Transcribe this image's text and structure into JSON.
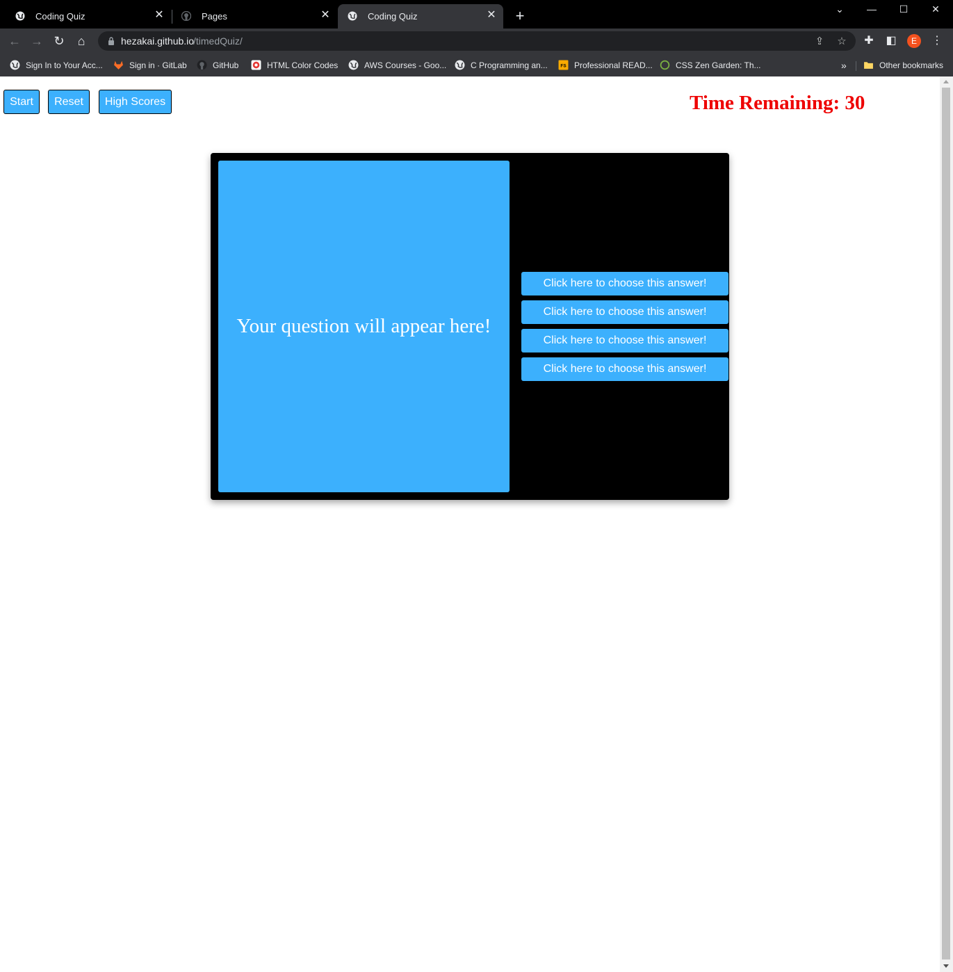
{
  "browser": {
    "tabs": [
      {
        "title": "Coding Quiz",
        "icon": "globe-icon",
        "active": false
      },
      {
        "title": "Pages",
        "icon": "github-icon",
        "active": false
      },
      {
        "title": "Coding Quiz",
        "icon": "globe-icon",
        "active": true
      }
    ],
    "address": {
      "host": "hezakai.github.io",
      "path": "/timedQuiz/"
    },
    "profile_initial": "E",
    "bookmarks": [
      {
        "label": "Sign In to Your Acc...",
        "icon": "globe-icon"
      },
      {
        "label": "Sign in · GitLab",
        "icon": "gitlab-icon"
      },
      {
        "label": "GitHub",
        "icon": "github-icon"
      },
      {
        "label": "HTML Color Codes",
        "icon": "html-color-codes-icon"
      },
      {
        "label": "AWS Courses - Goo...",
        "icon": "globe-icon"
      },
      {
        "label": "C Programming an...",
        "icon": "globe-icon"
      },
      {
        "label": "Professional READ...",
        "icon": "fs-icon"
      },
      {
        "label": "CSS Zen Garden: Th...",
        "icon": "zen-garden-icon"
      }
    ],
    "other_bookmarks": "Other bookmarks"
  },
  "page": {
    "controls": {
      "start_label": "Start",
      "reset_label": "Reset",
      "high_scores_label": "High Scores"
    },
    "timer_text": "Time Remaining: 30",
    "question_text": "Your question will appear here!",
    "answers": [
      "Click here to choose this answer!",
      "Click here to choose this answer!",
      "Click here to choose this answer!",
      "Click here to choose this answer!"
    ],
    "colors": {
      "accent": "#3cb0fd",
      "timer": "#ee0000",
      "card": "#000000"
    }
  }
}
